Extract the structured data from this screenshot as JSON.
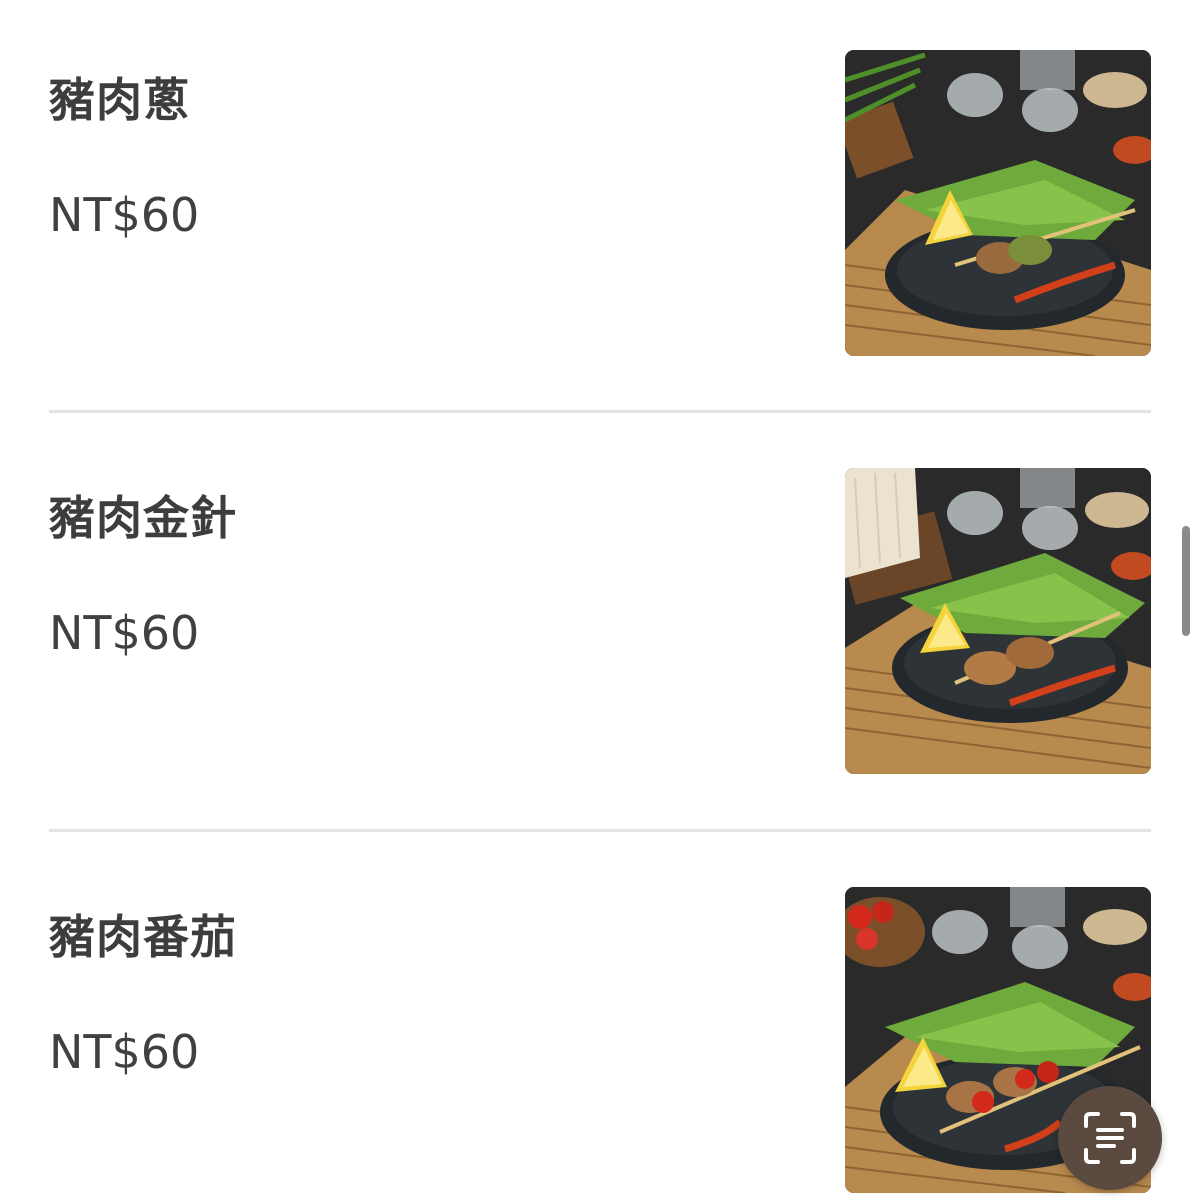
{
  "menu": {
    "items": [
      {
        "name": "豬肉蔥",
        "price": "NT$60",
        "photo_icon": "skewer-scallion-photo"
      },
      {
        "name": "豬肉金針",
        "price": "NT$60",
        "photo_icon": "skewer-enoki-photo"
      },
      {
        "name": "豬肉番茄",
        "price": "NT$60",
        "photo_icon": "skewer-tomato-photo"
      }
    ]
  },
  "fab": {
    "icon": "text-scan-icon",
    "color": "#5b4a40"
  },
  "colors": {
    "divider": "#e3e3e3",
    "text": "#3d3d3d",
    "background": "#ffffff"
  }
}
